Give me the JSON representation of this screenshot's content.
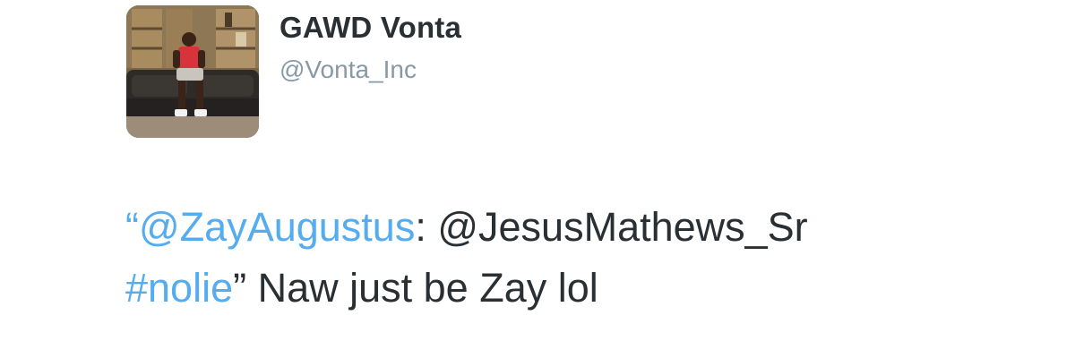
{
  "user": {
    "display_name": "GAWD Vonta",
    "handle": "@Vonta_Inc"
  },
  "tweet": {
    "open_quote": "“",
    "mention_1": "@ZayAugustus",
    "colon_space": ": ",
    "mention_2": "@JesusMathews_Sr",
    "hashtag": "#nolie",
    "close_quote_rest": "” Naw just be Zay lol"
  },
  "colors": {
    "link": "#55acee",
    "text": "#292f33",
    "handle": "#8899a6"
  }
}
